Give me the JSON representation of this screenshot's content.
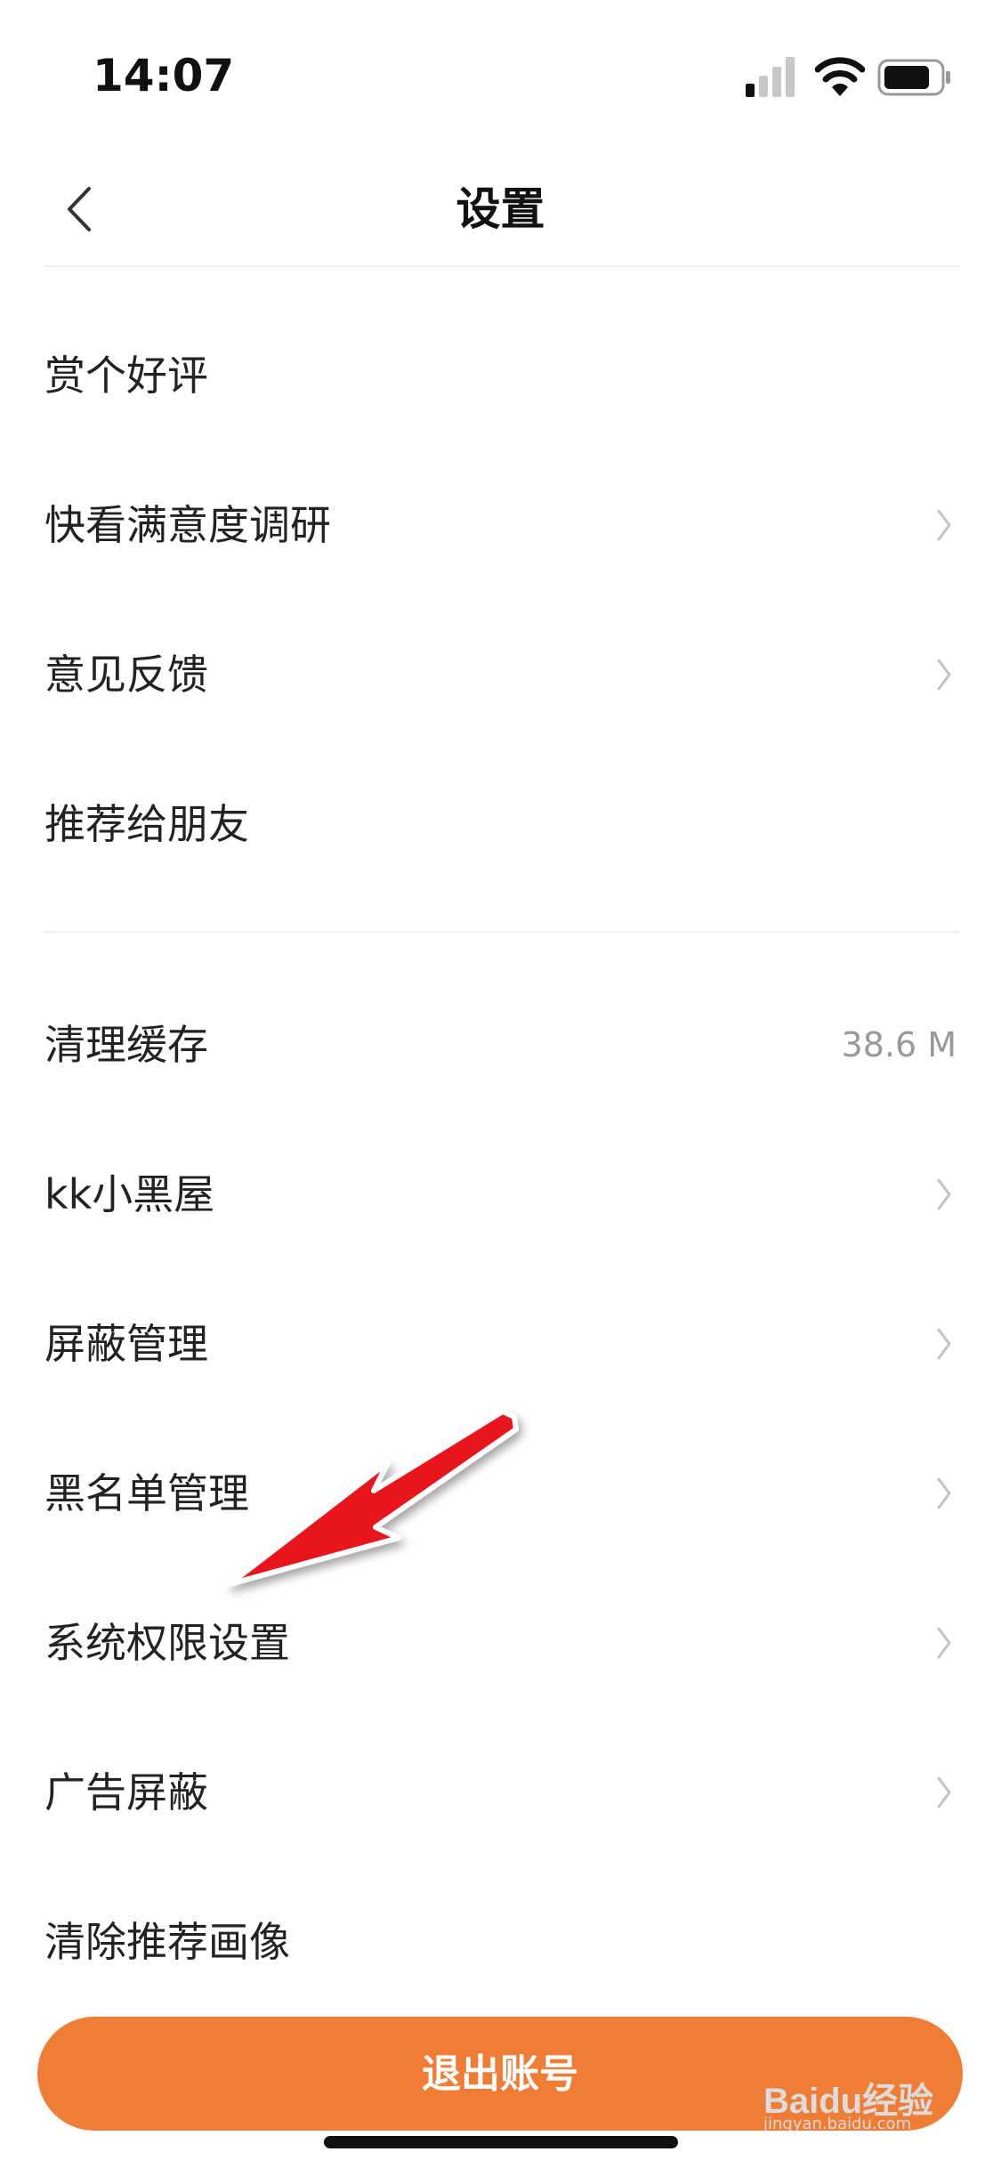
{
  "status_bar": {
    "time": "14:07"
  },
  "nav": {
    "title": "设置",
    "back_icon": "chevron-left-icon"
  },
  "group1": [
    {
      "label": "赏个好评",
      "chevron": false
    },
    {
      "label": "快看满意度调研",
      "chevron": true
    },
    {
      "label": "意见反馈",
      "chevron": true
    },
    {
      "label": "推荐给朋友",
      "chevron": false
    }
  ],
  "group2": [
    {
      "label": "清理缓存",
      "value": "38.6 M",
      "chevron": false
    },
    {
      "label": "kk小黑屋",
      "chevron": true
    },
    {
      "label": "屏蔽管理",
      "chevron": true
    },
    {
      "label": "黑名单管理",
      "chevron": true
    },
    {
      "label": "系统权限设置",
      "chevron": true
    },
    {
      "label": "广告屏蔽",
      "chevron": true
    },
    {
      "label": "清除推荐画像",
      "chevron": false
    }
  ],
  "logout": {
    "label": "退出账号"
  },
  "watermark": {
    "logo": "Baidu经验",
    "url": "jingyan.baidu.com"
  },
  "colors": {
    "accent": "#ef7d36",
    "annotation": "#e8131a",
    "value_gray": "#999999"
  }
}
